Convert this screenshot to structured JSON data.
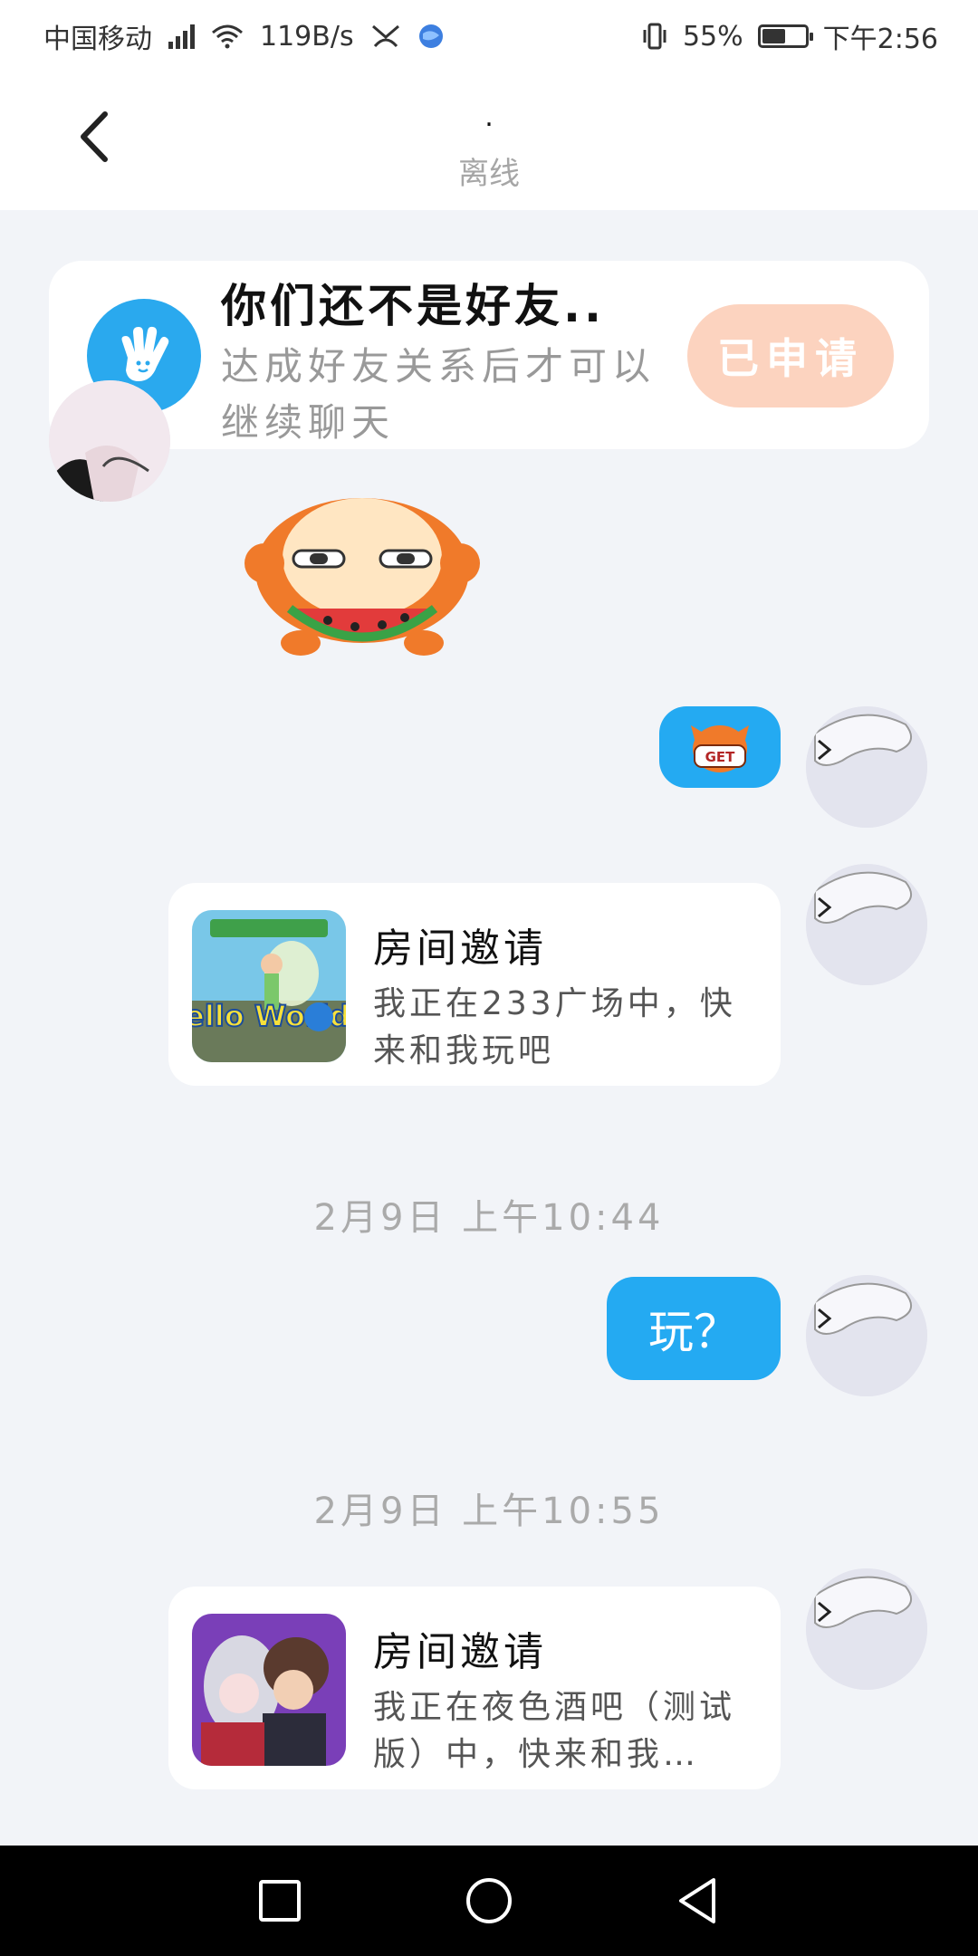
{
  "status_bar": {
    "carrier": "中国移动",
    "network_speed": "119B/s",
    "battery": "55%",
    "battery_level": 0.55,
    "time": "下午2:56"
  },
  "header": {
    "contact_name": ".",
    "contact_status": "离线"
  },
  "friend_notice": {
    "title": "你们还不是好友..",
    "subtitle": "达成好友关系后才可以继续聊天",
    "button_label": "已申请"
  },
  "messages": [
    {
      "type": "sticker",
      "side": "left",
      "icon": "watermelon-eating-sticker"
    },
    {
      "type": "sticker",
      "side": "right",
      "icon": "get-sticker",
      "text": "GET"
    },
    {
      "type": "room_invite",
      "side": "right",
      "title": "房间邀请",
      "text": "我正在233广场中，快来和我玩吧",
      "thumb_text": "Hello World"
    },
    {
      "type": "timestamp",
      "text": "2月9日 上午10:44"
    },
    {
      "type": "text",
      "side": "right",
      "text": "玩？"
    },
    {
      "type": "timestamp",
      "text": "2月9日 上午10:55"
    },
    {
      "type": "room_invite",
      "side": "right",
      "title": "房间邀请",
      "text": "我正在夜色酒吧（测试版）中，快来和我…"
    }
  ],
  "colors": {
    "accent_blue": "#24aaf2",
    "applied_button": "#fcd3bf",
    "background": "#f2f4f8"
  }
}
